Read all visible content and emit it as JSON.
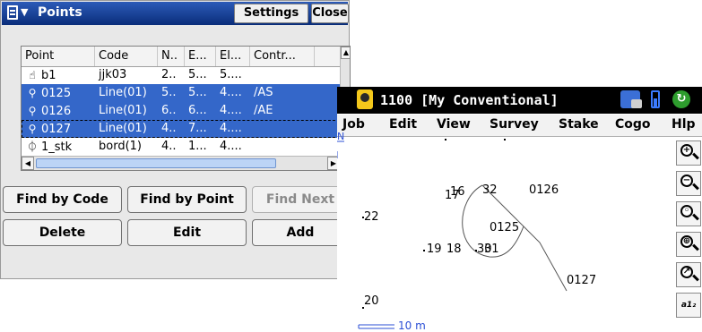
{
  "points_window": {
    "title": "Points",
    "settings_label": "Settings",
    "close_label": "Close",
    "columns": [
      "Point",
      "Code",
      "N..",
      "E...",
      "El...",
      "Contr..."
    ],
    "rows": [
      {
        "icon": "hand-point-icon",
        "point": "b1",
        "code": "jjk03",
        "n": "2..",
        "e": "5...",
        "el": "5....",
        "ctrl": "",
        "selected": false
      },
      {
        "icon": "stake-point-icon",
        "point": "0125",
        "code": "Line(01)",
        "n": "5..",
        "e": "5...",
        "el": "4....",
        "ctrl": "/AS",
        "selected": true
      },
      {
        "icon": "stake-point-icon",
        "point": "0126",
        "code": "Line(01)",
        "n": "6..",
        "e": "6...",
        "el": "4....",
        "ctrl": "/AE",
        "selected": true
      },
      {
        "icon": "stake-point-icon",
        "point": "0127",
        "code": "Line(01)",
        "n": "4..",
        "e": "7...",
        "el": "4....",
        "ctrl": "",
        "selected": true
      },
      {
        "icon": "stake-circle-icon",
        "point": "1_stk",
        "code": "bord(1)",
        "n": "4..",
        "e": "1...",
        "el": "4....",
        "ctrl": "",
        "selected": false
      }
    ],
    "find_by_code_label": "Find by Code",
    "find_by_point_label": "Find by Point",
    "find_next_label": "Find Next",
    "delete_label": "Delete",
    "edit_label": "Edit",
    "add_label": "Add"
  },
  "map_window": {
    "title": "1100 [My Conventional]",
    "menu": [
      "Job",
      "Edit",
      "View",
      "Survey",
      "Stake",
      "Cogo",
      "Hlp"
    ],
    "labels": [
      "16",
      "17",
      "32",
      "0126",
      "22",
      "0125",
      "19",
      "18",
      "30",
      "31",
      "0127",
      "20",
      "N"
    ],
    "scale_label": "10 m"
  }
}
